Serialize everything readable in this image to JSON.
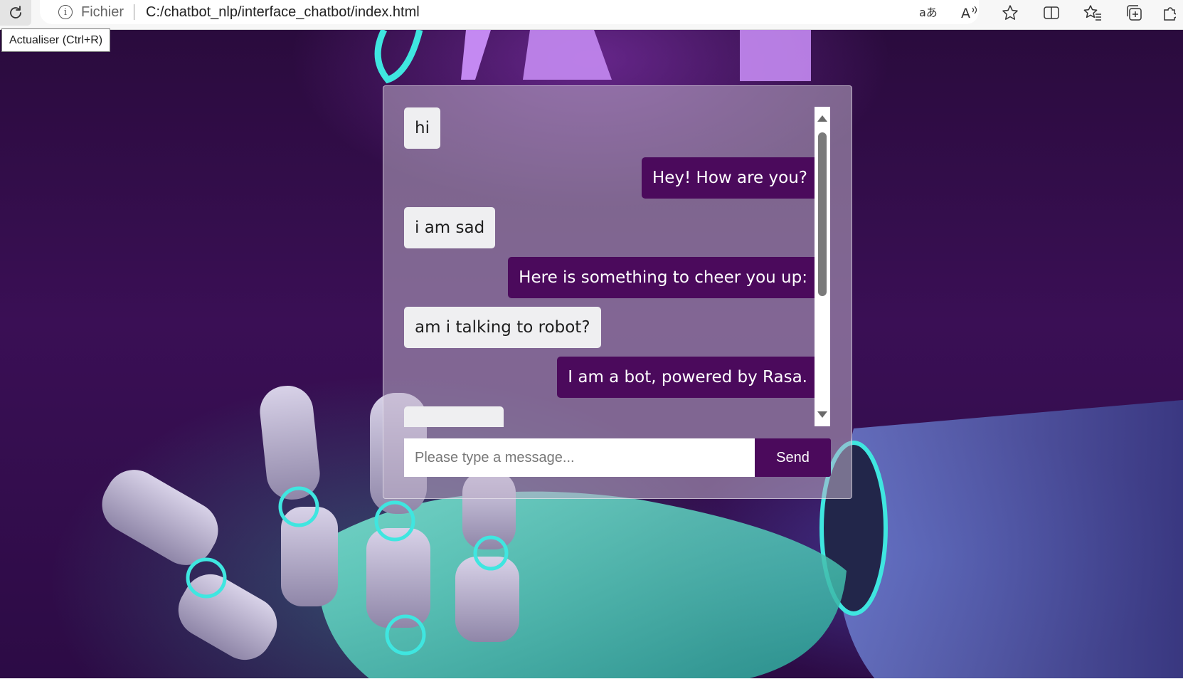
{
  "browser": {
    "tooltip": "Actualiser (Ctrl+R)",
    "scheme_label": "Fichier",
    "url": "C:/chatbot_nlp/interface_chatbot/index.html",
    "icons": [
      "reload-icon",
      "info-icon",
      "translate-icon",
      "read-aloud-icon",
      "favorite-star-icon",
      "split-screen-icon",
      "favorites-icon",
      "collections-icon",
      "extensions-icon"
    ]
  },
  "chat": {
    "messages": [
      {
        "sender": "user",
        "text": "hi"
      },
      {
        "sender": "bot",
        "text": "Hey! How are you?"
      },
      {
        "sender": "user",
        "text": "i am sad"
      },
      {
        "sender": "bot",
        "text": "Here is something to cheer you up:"
      },
      {
        "sender": "user",
        "text": "am i talking to robot?"
      },
      {
        "sender": "bot",
        "text": "I am a bot, powered by Rasa."
      }
    ],
    "input": {
      "value": "",
      "placeholder": "Please type a message..."
    },
    "send_label": "Send"
  },
  "colors": {
    "bot_bubble": "#4b0a5c",
    "user_bubble": "#efeff1",
    "send_button": "#4b0a5c"
  }
}
